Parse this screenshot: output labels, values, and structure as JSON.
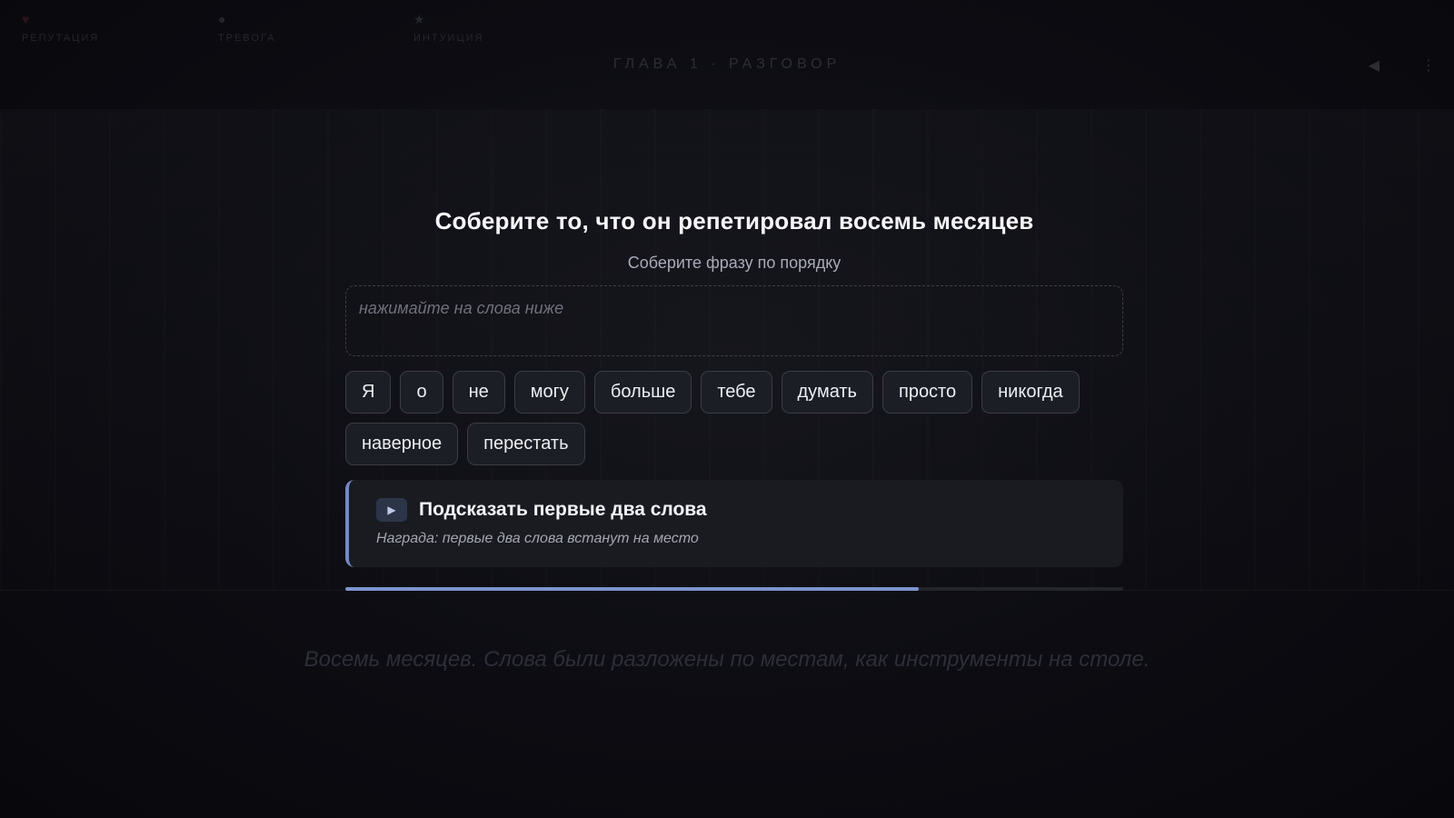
{
  "hud": {
    "stats": [
      {
        "icon": "heart-icon",
        "glyph": "♥",
        "label": "РЕПУТАЦИЯ"
      },
      {
        "icon": "dot-icon",
        "glyph": "●",
        "label": "ТРЕВОГА"
      },
      {
        "icon": "star-icon",
        "glyph": "★",
        "label": "ИНТУИЦИЯ"
      }
    ],
    "chapter": "ГЛАВА 1 · РАЗГОВОР",
    "sound_glyph": "◀",
    "menu_glyph": "⋮"
  },
  "puzzle": {
    "title": "Соберите то, что он репетировал восемь месяцев",
    "subtitle": "Соберите фразу по порядку",
    "answer_placeholder": "нажимайте на слова ниже",
    "words": [
      "Я",
      "о",
      "не",
      "могу",
      "больше",
      "тебе",
      "думать",
      "просто",
      "никогда",
      "наверное",
      "перестать"
    ],
    "hint": {
      "icon": "play-icon",
      "glyph": "▶",
      "title": "Подсказать первые два слова",
      "reward": "Награда: первые два слова встанут на место"
    },
    "progress": 0.737
  },
  "caption": "Восемь месяцев. Слова были разложены по местам, как инструменты на столе.",
  "colors": {
    "accent": "#7c93cf",
    "hint_border": "#6f8ac8",
    "background": "#0a0a10"
  }
}
